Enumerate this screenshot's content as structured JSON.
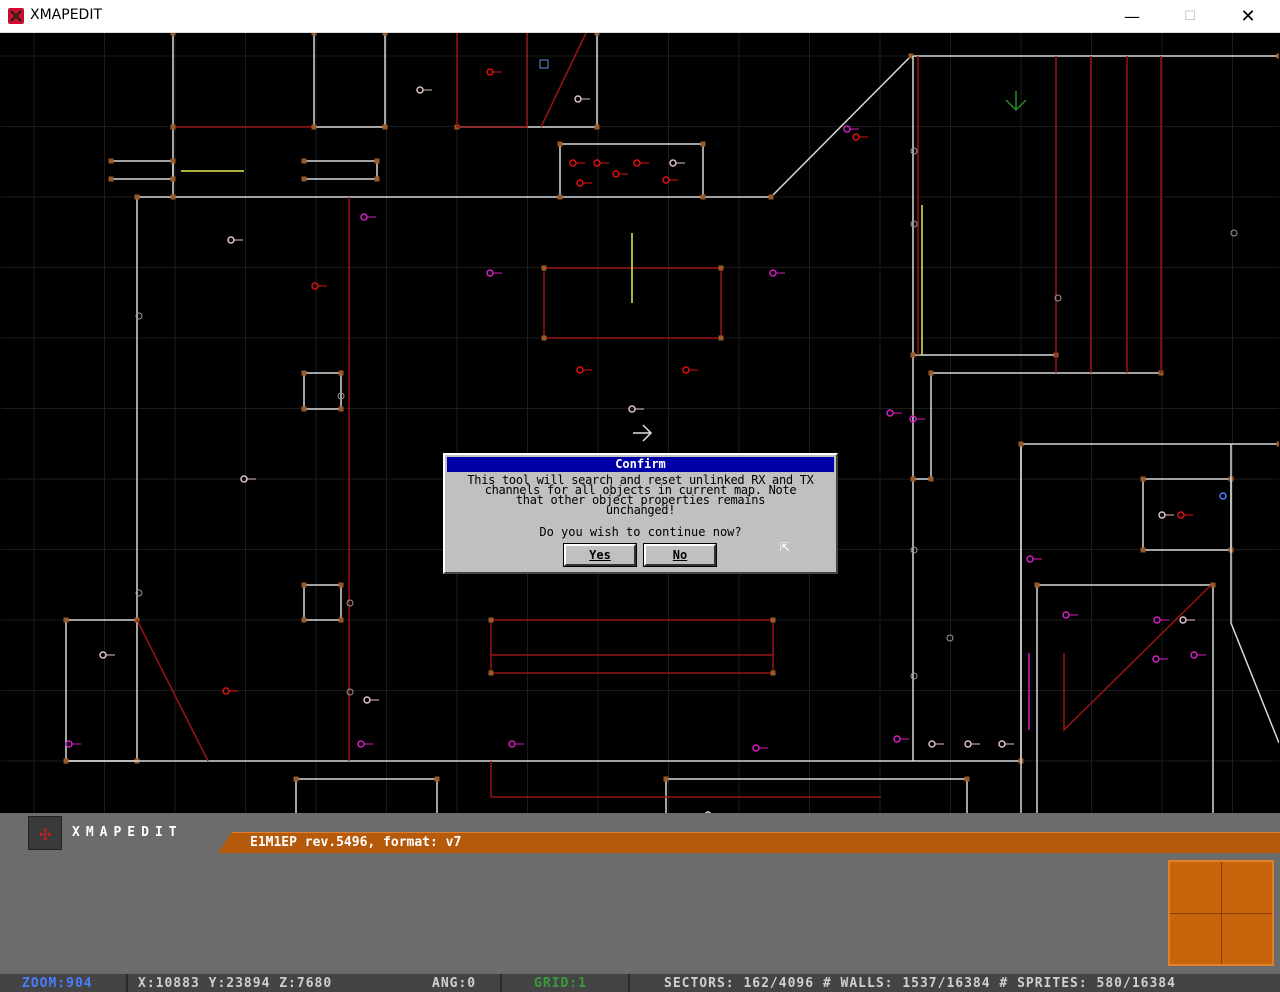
{
  "window": {
    "title": "XMAPEDIT",
    "min_glyph": "—",
    "max_glyph": "☐",
    "close_glyph": "✕"
  },
  "dialog": {
    "title": "Confirm",
    "message_lines": [
      "This tool will search and reset unlinked RX and TX",
      "channels for all objects in current map. Note",
      "that other object properties remains",
      "unchanged!"
    ],
    "question": "Do you wish to continue now?",
    "yes_label": "Yes",
    "no_label": "No"
  },
  "bottom_panel": {
    "logo_text": "XMAPEDIT",
    "map_info": "E1M1EP rev.5496, format: v7"
  },
  "status_bar": {
    "zoom": "ZOOM:904",
    "coords": "X:10883  Y:23894  Z:7680",
    "angle": "ANG:0",
    "grid": "GRID:1",
    "counts": "SECTORS: 162/4096 # WALLS: 1537/16384 # SPRITES: 580/16384"
  },
  "colors": {
    "map_bg": "#000000",
    "grid_line": "#1c1c1c",
    "wall_white": "#d8d8d8",
    "wall_red": "#9a1414",
    "vertex": "#9a5a28",
    "sprite_magenta": "#d020c0",
    "sprite_red": "#e01010",
    "highlight_yellow": "#e8e850",
    "panel_gray": "#6c6c6c",
    "info_orange": "#b45a0a",
    "dialog_title_blue": "#0000a8"
  }
}
